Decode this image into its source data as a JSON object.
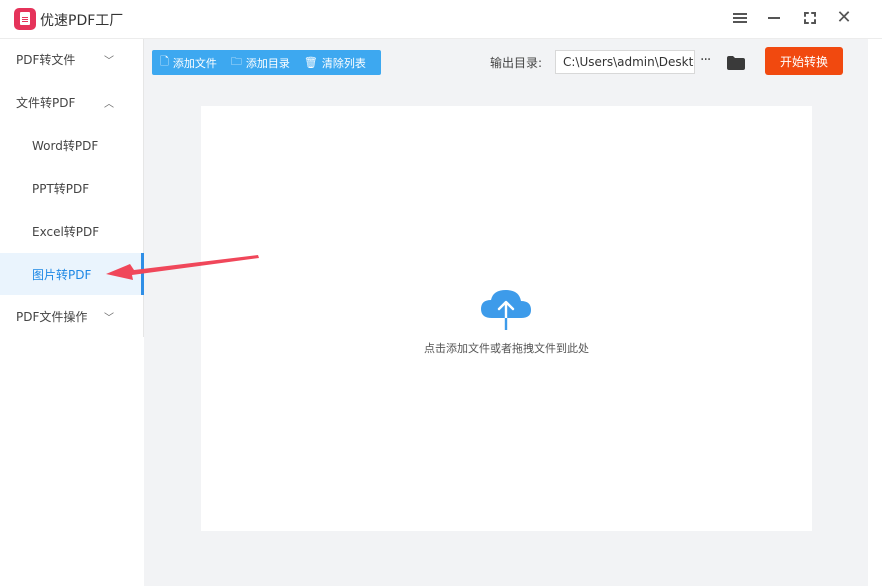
{
  "app": {
    "title": "优速PDF工厂"
  },
  "sidebar": {
    "items": [
      {
        "label": "PDF转文件",
        "chevron": "﹀"
      },
      {
        "label": "文件转PDF",
        "chevron": "︿"
      },
      {
        "label": "Word转PDF"
      },
      {
        "label": "PPT转PDF"
      },
      {
        "label": "Excel转PDF"
      },
      {
        "label": "图片转PDF",
        "active": true
      },
      {
        "label": "PDF文件操作",
        "chevron": "﹀"
      }
    ]
  },
  "toolbar": {
    "add_file": "添加文件",
    "add_folder": "添加目录",
    "clear_list": "清除列表",
    "output_label": "输出目录:",
    "output_path": "C:\\Users\\admin\\Deskto",
    "more": "···",
    "start": "开始转换"
  },
  "dropzone": {
    "hint": "点击添加文件或者拖拽文件到此处"
  },
  "colors": {
    "accent": "#3da8f0",
    "start": "#f1490f",
    "brand": "#e5335a",
    "arrow": "#f0475a"
  }
}
